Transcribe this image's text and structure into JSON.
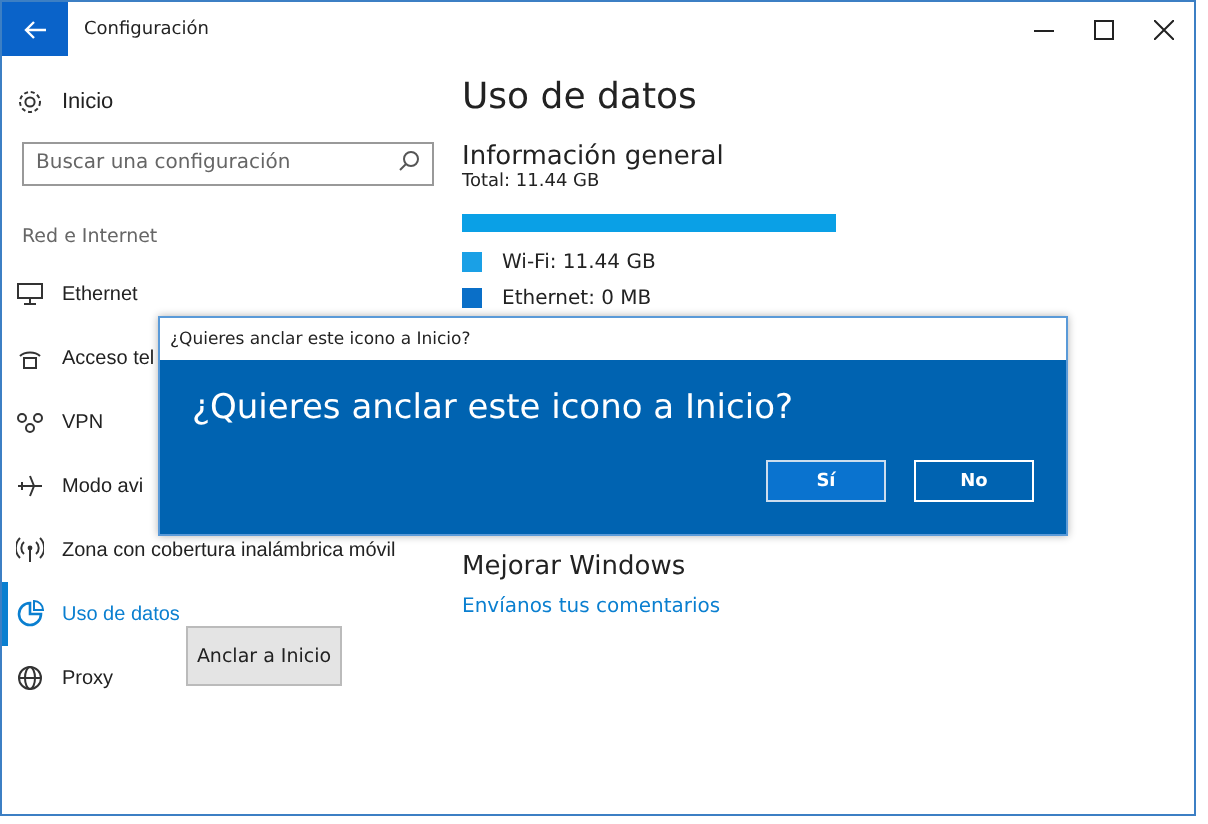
{
  "window": {
    "title": "Configuración"
  },
  "sidebar": {
    "home": "Inicio",
    "search": {
      "placeholder": "Buscar una configuración"
    },
    "section": "Red e Internet",
    "items": [
      {
        "label": "Ethernet",
        "kind": "ethernet",
        "selected": false
      },
      {
        "label": "Acceso tel",
        "kind": "dialup",
        "selected": false
      },
      {
        "label": "VPN",
        "kind": "vpn",
        "selected": false
      },
      {
        "label": "Modo avi",
        "kind": "airplane",
        "selected": false
      },
      {
        "label": "Zona con cobertura inalámbrica móvil",
        "kind": "hotspot",
        "selected": false
      },
      {
        "label": "Uso de datos",
        "kind": "pie",
        "selected": true
      },
      {
        "label": "Proxy",
        "kind": "globe",
        "selected": false
      }
    ]
  },
  "main": {
    "title": "Uso de datos",
    "overview": {
      "heading": "Información general",
      "total": "Total: 11.44 GB",
      "usage": {
        "level": 1
      },
      "legend": [
        {
          "label": "Wi-Fi:  11.44 GB",
          "color": "#1aa0e6"
        },
        {
          "label": "Ethernet:  0 MB",
          "color": "#0a6fc8"
        }
      ]
    },
    "feedback": {
      "heading": "Mejorar Windows",
      "link": "Envíanos tus comentarios"
    }
  },
  "context_menu": {
    "items": [
      "Anclar a Inicio"
    ]
  },
  "dialog": {
    "title": "¿Quieres anclar este icono a Inicio?",
    "message": "¿Quieres anclar este icono a Inicio?",
    "buttons": [
      "Sí",
      "No"
    ]
  }
}
